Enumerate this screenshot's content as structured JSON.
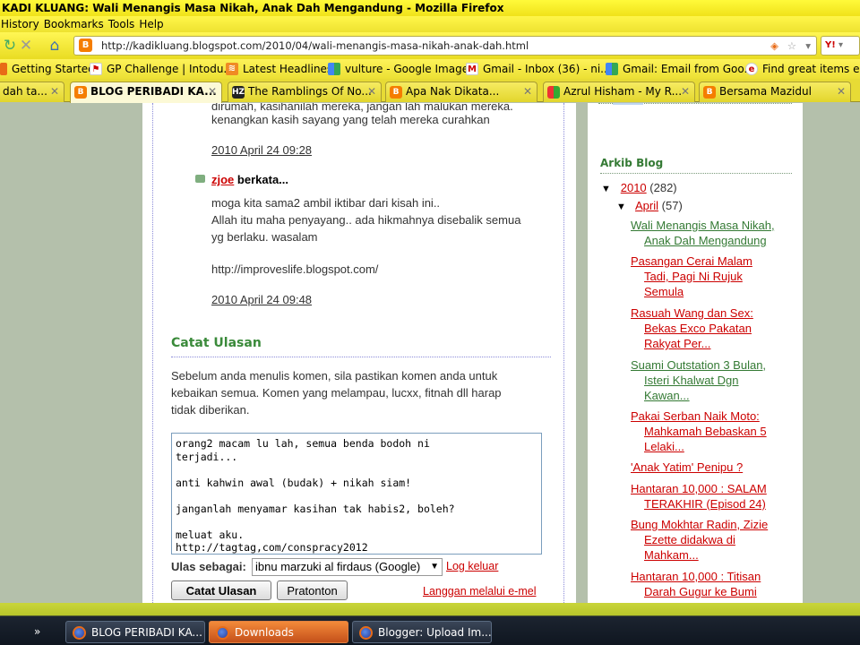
{
  "window": {
    "title": "KADI KLUANG: Wali Menangis Masa Nikah, Anak Dah Mengandung - Mozilla Firefox"
  },
  "menu": {
    "items": [
      "History",
      "Bookmarks",
      "Tools",
      "Help"
    ]
  },
  "address": {
    "url": "http://kadikluang.blogspot.com/2010/04/wali-menangis-masa-nikah-anak-dah.html",
    "search_engine_label": "Y!"
  },
  "bookmarks": [
    "Getting Started",
    "GP Challenge | Intodu...",
    "Latest Headlines",
    "vulture - Google Images",
    "Gmail - Inbox (36) - ni...",
    "Gmail: Email from Goo...",
    "Find great items en"
  ],
  "tabs": [
    {
      "label": "dah ta..."
    },
    {
      "label": "BLOG PERIBADI KA..."
    },
    {
      "label": "The Ramblings Of No..."
    },
    {
      "label": "Apa Nak Dikata..."
    },
    {
      "label": "Azrul Hisham - My R..."
    },
    {
      "label": "Bersama Mazidul"
    }
  ],
  "comments": {
    "partial_line1": "dirumah, kasihanilah mereka, jangan lah malukan mereka.",
    "partial_line2": "kenangkan kasih sayang yang telah mereka curahkan",
    "timestamp1": "2010 April 24 09:28",
    "author2": "zjoe",
    "berkata": "berkata...",
    "body2_line1": "moga kita sama2 ambil iktibar dari kisah ini..",
    "body2_line2": "Allah itu maha penyayang.. ada hikmahnya disebalik semua",
    "body2_line3": "yg berlaku. wasalam",
    "body2_link": "http://improveslife.blogspot.com/",
    "timestamp2": "2010 April 24 09:48"
  },
  "comment_form": {
    "heading": "Catat Ulasan",
    "notice_line1": "Sebelum anda menulis komen, sila pastikan komen anda untuk",
    "notice_line2": "kebaikan semua. Komen yang melampau, lucxx, fitnah dll harap",
    "notice_line3": "tidak diberikan.",
    "textarea_value": "orang2 macam lu lah, semua benda bodoh ni\nterjadi...\n\nanti kahwin awal (budak) + nikah siam!\n\njanganlah menyamar kasihan tak habis2, boleh?\n\nmeluat aku.\nhttp://tagtag,com/conspracy2012",
    "ulas_label": "Ulas sebagai:",
    "identity_selected": "ibnu marzuki al firdaus (Google)",
    "logout": "Log keluar",
    "submit": "Catat Ulasan",
    "preview": "Pratonton",
    "subscribe": "Langgan melalui e-mel"
  },
  "sidebar": {
    "title": "Arkib Blog",
    "year": "2010",
    "year_count": "(282)",
    "month": "April",
    "month_count": "(57)",
    "posts": [
      {
        "line1": "Wali Menangis Masa Nikah,",
        "line2": "Anak Dah Mengandung"
      },
      {
        "line1": "Pasangan Cerai Malam",
        "line2": "Tadi, Pagi Ni Rujuk",
        "line3": "Semula"
      },
      {
        "line1": "Rasuah Wang dan Sex:",
        "line2": "Bekas Exco Pakatan",
        "line3": "Rakyat Per..."
      },
      {
        "line1": "Suami Outstation 3 Bulan,",
        "line2": "Isteri Khalwat Dgn",
        "line3": "Kawan..."
      },
      {
        "line1": "Pakai Serban Naik Moto:",
        "line2": "Mahkamah Bebaskan 5",
        "line3": "Lelaki..."
      },
      {
        "line1": "'Anak Yatim' Penipu ?"
      },
      {
        "line1": "Hantaran 10,000 : SALAM",
        "line2": "TERAKHIR (Episod 24)"
      },
      {
        "line1": "Bung Mokhtar Radin, Zizie",
        "line2": "Ezette didakwa di",
        "line3": "Mahkam..."
      },
      {
        "line1": "Hantaran 10,000 : Titisan",
        "line2": "Darah Gugur ke Bumi"
      }
    ]
  },
  "taskbar": {
    "items": [
      "BLOG PERIBADI KA...",
      "Downloads",
      "Blogger: Upload Im..."
    ]
  },
  "colors": {
    "title_yellow": "#fff53a",
    "link_red": "#cc0000",
    "link_green": "#347a34",
    "heading_green": "#3a8a3a"
  }
}
